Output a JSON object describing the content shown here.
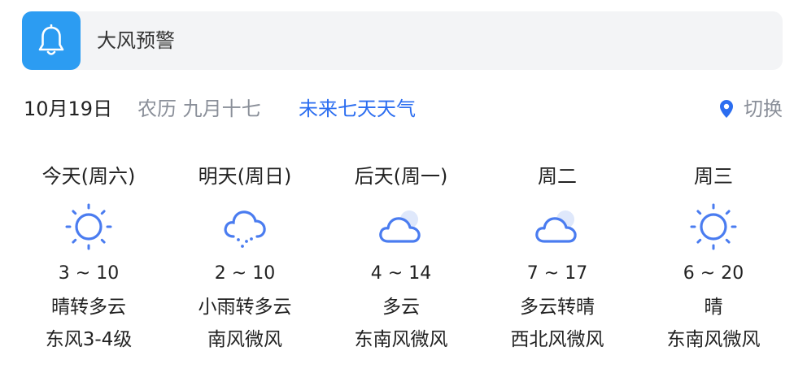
{
  "alert": {
    "icon": "bell-icon",
    "text": "大风预警"
  },
  "date_bar": {
    "solar": "10月19日",
    "lunar": "农历 九月十七",
    "forecast_link": "未来七天天气",
    "switch_icon": "location-pin-icon",
    "switch_label": "切换"
  },
  "days": [
    {
      "name": "今天(周六)",
      "icon": "sun-icon",
      "temp": "3 ~ 10",
      "condition": "晴转多云",
      "wind": "东风3-4级"
    },
    {
      "name": "明天(周日)",
      "icon": "rain-cloud-icon",
      "temp": "2 ~ 10",
      "condition": "小雨转多云",
      "wind": "南风微风"
    },
    {
      "name": "后天(周一)",
      "icon": "cloudy-icon",
      "temp": "4 ~ 14",
      "condition": "多云",
      "wind": "东南风微风"
    },
    {
      "name": "周二",
      "icon": "cloudy-icon",
      "temp": "7 ~ 17",
      "condition": "多云转晴",
      "wind": "西北风微风"
    },
    {
      "name": "周三",
      "icon": "sun-icon",
      "temp": "6 ~ 20",
      "condition": "晴",
      "wind": "东南风微风"
    }
  ],
  "colors": {
    "accent_blue": "#2b6df0",
    "alert_blue": "#2c9cf2",
    "icon_blue": "#4a7cf0",
    "muted_gray": "#8a8f99"
  }
}
